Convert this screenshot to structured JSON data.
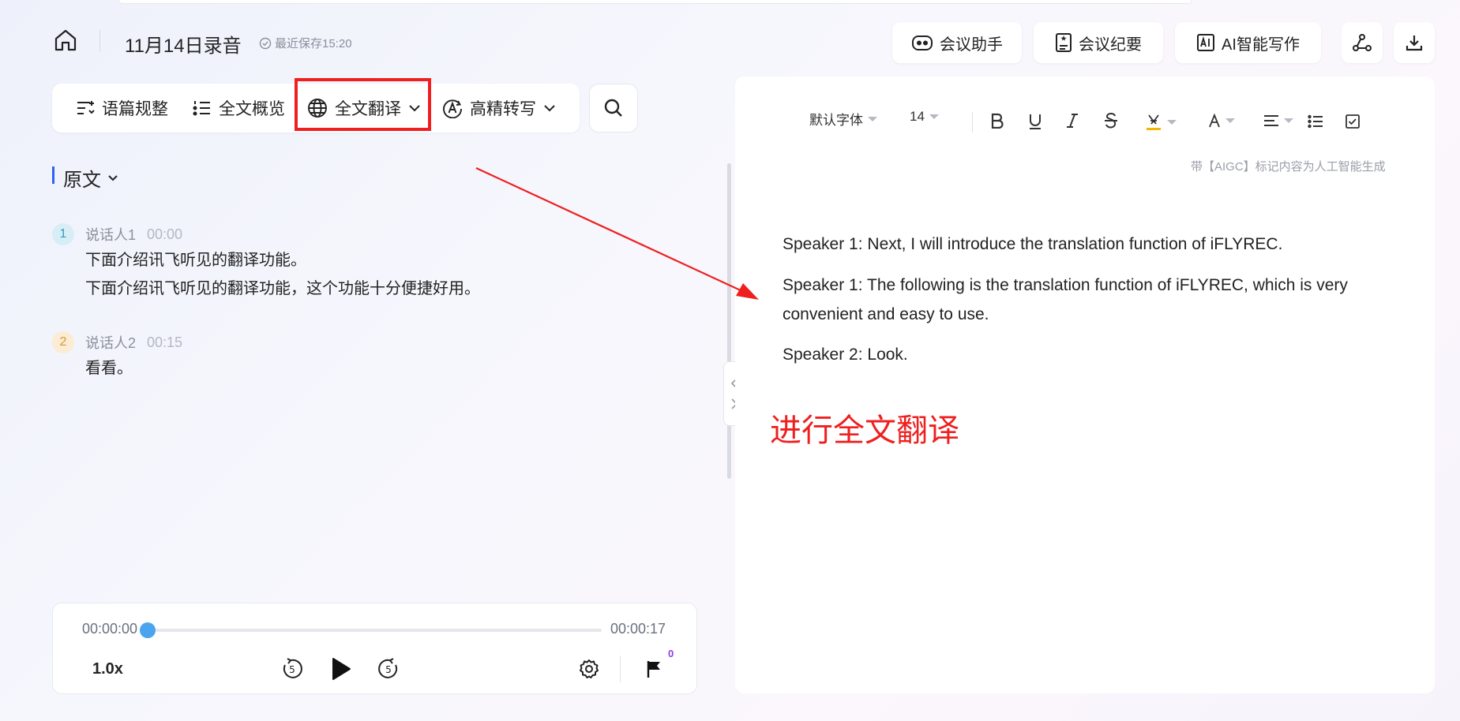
{
  "header": {
    "title": "11月14日录音",
    "saved_status": "最近保存15:20",
    "buttons": {
      "meeting_assistant": "会议助手",
      "meeting_minutes": "会议纪要",
      "ai_writing": "AI智能写作"
    }
  },
  "toolbar": {
    "items": {
      "paragraph_regulation": "语篇规整",
      "full_overview": "全文概览",
      "full_translation": "全文翻译",
      "high_precision": "高精转写"
    }
  },
  "left": {
    "section_title": "原文",
    "speakers": [
      {
        "num": "1",
        "name": "说话人1",
        "time": "00:00",
        "lines": [
          "下面介绍讯飞听见的翻译功能。",
          "下面介绍讯飞听见的翻译功能，这个功能十分便捷好用。"
        ]
      },
      {
        "num": "2",
        "name": "说话人2",
        "time": "00:15",
        "lines": [
          "看看。"
        ]
      }
    ]
  },
  "player": {
    "current_time": "00:00:00",
    "total_time": "00:00:17",
    "progress": 0,
    "speed": "1.0x",
    "flag_count": "0",
    "rewind_label": "5",
    "forward_label": "5"
  },
  "editor": {
    "font": "默认字体",
    "size": "14",
    "aigc_note": "带【AIGC】标记内容为人工智能生成",
    "paragraphs": [
      "Speaker 1: Next, I will introduce the translation function of iFLYREC.",
      "Speaker 1: The following is the translation function of iFLYREC, which is very convenient and easy to use.",
      "Speaker 2: Look."
    ]
  },
  "annotation": {
    "text": "进行全文翻译",
    "color": "#ef1f1f"
  },
  "colors": {
    "accent": "#2f64f2",
    "progress_knob": "#4aa4ee",
    "highlight_yellow": "#f5b400",
    "badge_purple": "#8b3df0"
  }
}
